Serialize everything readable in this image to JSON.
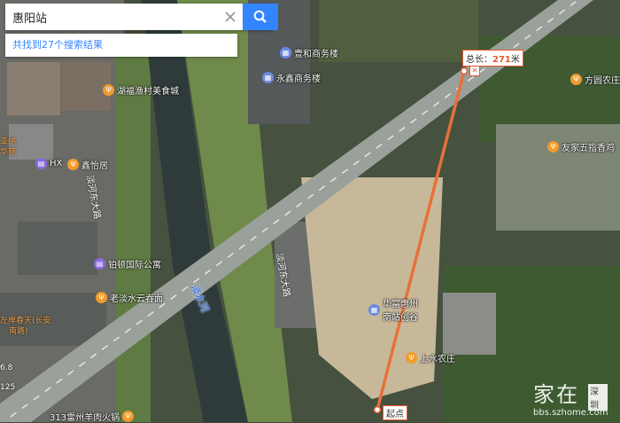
{
  "search": {
    "value": "惠阳站"
  },
  "results": {
    "text": "共找到27个搜索结果"
  },
  "pois": [
    {
      "name": "壹和商务楼",
      "type": "bldg"
    },
    {
      "name": "永鑫商务楼",
      "type": "bldg"
    },
    {
      "name": "湖福渔村美食城",
      "type": "food"
    },
    {
      "name": "HX",
      "type": "hotel"
    },
    {
      "name": "鑫怡居",
      "type": "food"
    },
    {
      "name": "铂顿国际公寓",
      "type": "hotel"
    },
    {
      "name": "老淡水云吞面",
      "type": "food"
    },
    {
      "name": "方圆农庄",
      "type": "food"
    },
    {
      "name": "友家五指香鸡",
      "type": "food"
    },
    {
      "name": "华富惠州南站创谷",
      "type": "bldg"
    },
    {
      "name": "上水农庄",
      "type": "food"
    },
    {
      "name": "313雷州羊肉火锅",
      "type": "food"
    }
  ],
  "roads": {
    "road1": "淡河东大路",
    "road2": "淡河东大路",
    "river": "淡水河"
  },
  "left_edge": {
    "label1": "亚纳",
    "label2": "华苑",
    "label3": "左岸春天(长安",
    "label4": "南路)",
    "label5": "6.8",
    "label6": "125"
  },
  "measure": {
    "prefix": "总长：",
    "value": "271",
    "unit": "米",
    "start": "起点",
    "close": "✕"
  },
  "watermark": {
    "main": "家在",
    "badge": "深圳",
    "sub": "bbs.szhome.com"
  },
  "colors": {
    "measure_line": "#e8703a",
    "search_button": "#3385ff"
  }
}
